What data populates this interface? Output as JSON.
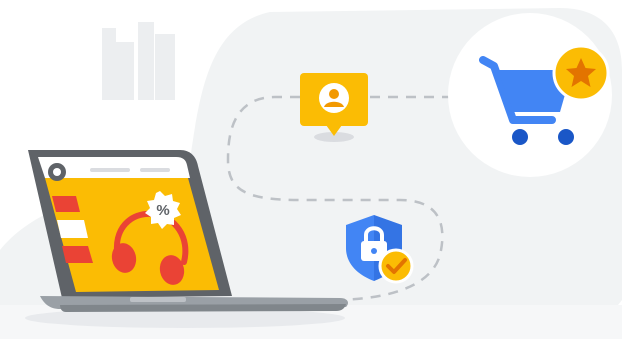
{
  "illustration": {
    "discount_badge_text": "%",
    "icons": {
      "user": "user-profile-icon",
      "cart": "shopping-cart-icon",
      "star": "star-icon",
      "shield": "shield-lock-icon",
      "check": "check-icon",
      "headphones": "headphones-icon",
      "browser_logo": "browser-logo-icon"
    },
    "colors": {
      "background_blob": "#f1f3f4",
      "yellow": "#fbbc04",
      "blue": "#4285f4",
      "dark_blue": "#1a57c7",
      "red": "#ea4335",
      "laptop_gray": "#5f6368",
      "laptop_base": "#9aa0a6",
      "dashes": "#bdc1c6"
    }
  }
}
